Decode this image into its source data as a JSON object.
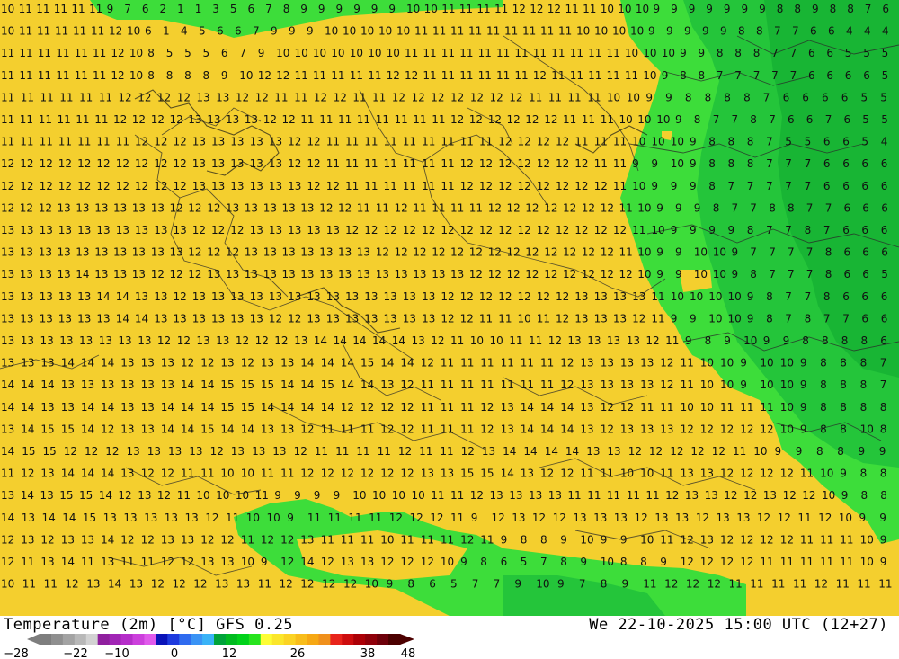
{
  "title": {
    "left": "Temperature (2m) [°C] GFS 0.25",
    "right": "We 22-10-2025 15:00 UTC (12+27)"
  },
  "colorbar": {
    "labels": [
      "-28",
      "-22",
      "-10",
      "0",
      "12",
      "26",
      "38",
      "48"
    ],
    "colors": [
      "#7e7e7e",
      "#8f8f8f",
      "#a3a3a3",
      "#b8b8b8",
      "#d2d2d2",
      "#8f1f9e",
      "#a126b5",
      "#b52ec9",
      "#cc40dc",
      "#e05aeb",
      "#0a13b8",
      "#1e3bde",
      "#2f6bef",
      "#3a93f5",
      "#3ab3f7",
      "#00a33a",
      "#00bb20",
      "#00d21a",
      "#27e41e",
      "#fdfd35",
      "#fbe62b",
      "#fbd324",
      "#f8bd1b",
      "#f6a814",
      "#f0901c",
      "#e8241b",
      "#cd0d0e",
      "#ac0007",
      "#8f000a",
      "#6e000a",
      "#4c0000"
    ]
  },
  "palette": {
    "yellow": "#f4cf2e",
    "yellow_light": "#f8dc3a",
    "green_light": "#3ddd3a",
    "green": "#24c53a",
    "green_dark": "#18b534",
    "border": "#2a2a2a"
  },
  "grid_rows": [
    "10 11 11 11 11 11 9 7 6 2 1 1 3 5 6 7 8 9 9 9 9 9 9 10 10 11 11 11 11 12 12 12 11 11 10 10 10 9 9 9 9 9 9 9 8 8 9 8 8 7 6",
    "10 11 11 11 11 11 12 10 6 1 4 5 6 6 7 9 9 9 10 10 10 10 10 11 11 11 11 11 11 11 11 11 10 10 10 10 9 9 9 9 9 8 8 7 7 6 6 4 4 4",
    "11 11 11 11 11 11 12 10 8 5 5 5 6 7 9 10 10 10 10 10 10 10 11 11 11 11 11 11 11 11 11 11 11 11 10 10 10 9 9 8 8 8 7 7 6 6 5 5 5",
    "11 11 11 11 11 11 12 10 8 8 8 8 9 10 12 12 11 11 11 11 11 12 12 11 11 11 11 11 11 12 11 11 11 11 11 10 9 8 8 7 7 7 7 7 6 6 6 6 5",
    "11 11 11 11 11 11 12 12 12 12 13 13 12 12 11 11 12 12 11 11 12 12 12 12 12 12 12 11 11 11 11 10 10 9 9 8 8 8 8 7 6 6 6 6 5 5",
    "11 11 11 11 11 11 12 12 12 12 13 13 13 13 12 12 11 11 11 11 11 11 11 11 12 12 12 12 12 12 11 11 11 10 10 10 9 8 7 7 8 7 6 6 7 6 5 5",
    "11 11 11 11 11 11 11 12 12 12 13 13 13 13 13 12 12 11 11 11 11 11 11 11 11 11 12 12 12 12 11 11 11 10 10 10 9 8 8 8 7 5 5 6 6 5 4",
    "12 12 12 12 12 12 12 12 12 12 13 13 13 13 13 12 12 11 11 11 11 11 11 11 12 12 12 12 12 12 12 11 11 9 9 10 9 8 8 8 7 7 7 6 6 6 6",
    "12 12 12 12 12 12 12 12 12 12 13 13 13 13 13 13 12 12 11 11 11 11 11 11 12 12 12 12 12 12 12 12 11 10 9 9 9 8 7 7 7 7 7 6 6 6 6",
    "12 12 12 13 13 13 13 13 13 12 12 12 13 13 13 13 13 12 12 11 11 12 11 11 11 11 12 12 12 12 12 12 12 11 10 9 9 9 8 7 7 8 8 7 7 6 6 6",
    "13 13 13 13 13 13 13 13 13 13 12 12 12 13 13 13 13 13 12 12 12 12 12 12 12 12 12 12 12 12 12 12 12 11 10 9 9 9 9 8 7 7 8 7 6 6 6",
    "13 13 13 13 13 13 13 13 13 13 12 12 12 13 13 13 13 13 13 13 12 12 12 12 12 12 12 12 12 12 12 12 12 11 10 9 9 10 10 9 7 7 7 7 8 6 6 6",
    "13 13 13 13 14 13 13 13 12 12 12 13 13 13 13 13 13 13 13 13 13 13 13 13 13 12 12 12 12 12 12 12 12 12 10 9 9 10 10 9 8 7 7 7 8 6 6 5",
    "13 13 13 13 13 14 14 13 13 12 13 13 13 13 13 13 13 13 13 13 13 13 13 12 12 12 12 12 12 12 13 13 13 13 11 10 10 10 10 9 8 7 7 8 6 6 6",
    "13 13 13 13 13 13 14 14 13 13 13 13 13 13 12 12 13 13 13 13 13 13 13 12 12 11 11 10 11 12 13 13 13 12 11 9 9 10 10 9 8 7 8 7 7 6 6",
    "13 13 13 13 13 13 13 13 12 12 13 13 12 12 12 13 14 14 14 14 14 13 12 11 10 10 11 11 12 13 13 13 13 12 11 9 8 9 10 9 9 8 8 8 8 6",
    "13 13 13 14 14 14 13 13 13 12 12 13 12 13 13 14 14 14 15 14 14 12 11 11 11 11 11 11 12 13 13 13 13 12 11 10 10 9 10 10 9 8 8 8 7",
    "14 14 14 13 13 13 13 13 13 14 14 15 15 15 14 14 15 14 14 13 12 11 11 11 11 11 11 11 12 13 13 13 13 12 11 10 10 9 10 10 9 8 8 8 7",
    "14 14 13 13 14 14 13 13 14 14 14 15 15 14 14 14 14 12 12 12 12 11 11 11 12 13 14 14 14 13 12 12 11 11 10 10 11 11 11 10 9 8 8 8 8",
    "13 14 15 15 14 12 13 13 14 14 15 14 14 13 13 12 11 11 11 12 12 11 11 11 12 13 14 14 14 13 12 13 13 13 12 12 12 12 12 10 9 8 8 10 8",
    "14 15 15 12 12 12 13 13 13 13 12 13 13 13 12 11 11 11 11 12 11 11 12 13 14 14 14 14 13 13 12 12 12 12 12 11 10 9 9 8 8 9 9",
    "11 12 13 14 14 14 13 12 12 11 11 10 10 11 11 12 12 12 12 12 12 13 13 15 15 14 13 12 12 11 11 10 10 11 13 13 12 12 12 12 11 10 9 8 8",
    "13 14 13 15 15 14 12 13 12 11 10 10 10 11 9 9 9 9 10 10 10 10 11 11 12 13 13 13 13 11 11 11 11 11 12 13 13 12 12 13 12 12 10 9 8 8",
    "14 13 14 14 15 13 13 13 13 13 12 11 10 10 9 11 11 11 11 12 12 12 11 9 12 13 12 12 13 13 13 12 13 13 12 13 13 12 12 11 12 10 9 9",
    "12 13 12 13 13 14 12 12 13 13 12 12 11 12 12 13 11 11 11 10 11 11 11 12 11 9 8 8 9 10 9 9 10 11 12 13 12 12 12 12 11 11 11 10 9",
    "12 11 13 14 11 13 11 11 12 12 13 13 10 9 12 14 12 13 13 12 12 12 10 9 8 6 5 7 8 9 10 8 8 9 12 12 12 12 11 11 11 11 11 10 9",
    "10 11 11 12 13 14 13 12 12 12 13 13 11 12 12 12 12 10 9 8 6 5 7 7 9 10 9 7 8 9 11 12 12 12 11 11 11 11 12 11 11 11"
  ]
}
